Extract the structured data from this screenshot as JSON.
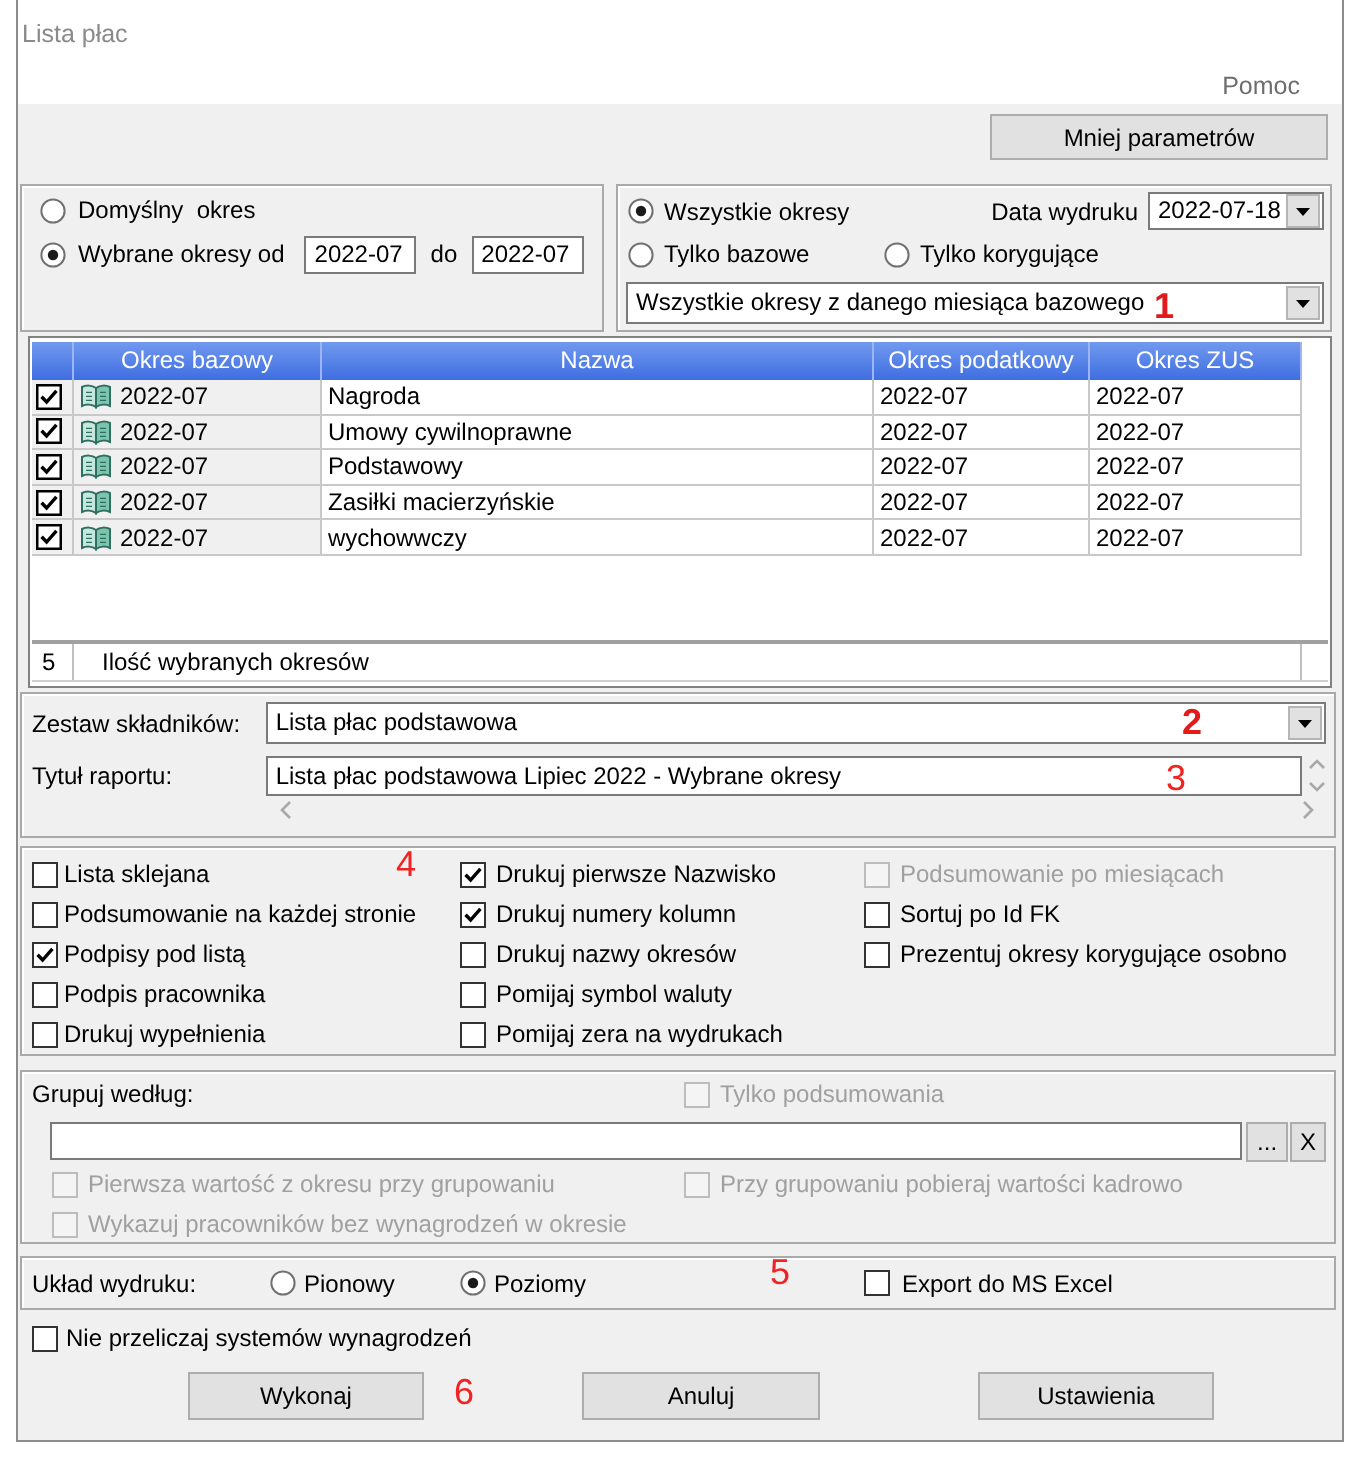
{
  "window": {
    "title": "Lista płac"
  },
  "menu": [
    {
      "label": "Pomoc"
    }
  ],
  "toggle_button": {
    "label": "Mniej parametrów"
  },
  "period_range": {
    "options": [
      {
        "label": "Domyślny  okres",
        "selected": false
      },
      {
        "label": "Wybrane okresy od",
        "selected": true
      }
    ],
    "from": "2022-07",
    "to_label": "do",
    "to": "2022-07"
  },
  "period_filter": {
    "options": [
      {
        "label": "Wszystkie okresy",
        "selected": true
      },
      {
        "label": "Tylko bazowe",
        "selected": false
      },
      {
        "label": "Tylko korygujące",
        "selected": false
      }
    ],
    "print_date_label": "Data wydruku",
    "print_date": "2022-07-18",
    "scope": "Wszystkie okresy z danego miesiąca bazowego"
  },
  "periods_table": {
    "columns": [
      "Okres bazowy",
      "Nazwa",
      "Okres podatkowy",
      "Okres ZUS"
    ],
    "rows": [
      {
        "checked": true,
        "base": "2022-07",
        "name": "Nagroda",
        "tax": "2022-07",
        "zus": "2022-07"
      },
      {
        "checked": true,
        "base": "2022-07",
        "name": "Umowy cywilnoprawne",
        "tax": "2022-07",
        "zus": "2022-07"
      },
      {
        "checked": true,
        "base": "2022-07",
        "name": "Podstawowy",
        "tax": "2022-07",
        "zus": "2022-07"
      },
      {
        "checked": true,
        "base": "2022-07",
        "name": "Zasiłki macierzyńskie",
        "tax": "2022-07",
        "zus": "2022-07"
      },
      {
        "checked": true,
        "base": "2022-07",
        "name": "wychowwczy",
        "tax": "2022-07",
        "zus": "2022-07"
      }
    ],
    "footer": {
      "count": "5",
      "label": "Ilość wybranych okresów"
    }
  },
  "component_set": {
    "label": "Zestaw składników:",
    "value": "Lista płac podstawowa"
  },
  "report_title": {
    "label": "Tytuł raportu:",
    "value": "Lista płac podstawowa Lipiec 2022 - Wybrane okresy"
  },
  "print_options": [
    {
      "items": [
        {
          "label": "Lista sklejana",
          "checked": false,
          "disabled": false
        },
        {
          "label": "Podsumowanie na każdej stronie",
          "checked": false,
          "disabled": false
        },
        {
          "label": "Podpisy pod listą",
          "checked": true,
          "disabled": false
        },
        {
          "label": "Podpis pracownika",
          "checked": false,
          "disabled": false
        },
        {
          "label": "Drukuj wypełnienia",
          "checked": false,
          "disabled": false
        }
      ]
    },
    {
      "items": [
        {
          "label": "Drukuj pierwsze Nazwisko",
          "checked": true,
          "disabled": false
        },
        {
          "label": "Drukuj numery kolumn",
          "checked": true,
          "disabled": false
        },
        {
          "label": "Drukuj nazwy okresów",
          "checked": false,
          "disabled": false
        },
        {
          "label": "Pomijaj symbol waluty",
          "checked": false,
          "disabled": false
        },
        {
          "label": "Pomijaj zera na wydrukach",
          "checked": false,
          "disabled": false
        }
      ]
    },
    {
      "items": [
        {
          "label": "Podsumowanie po miesiącach",
          "checked": false,
          "disabled": true
        },
        {
          "label": "Sortuj po Id FK",
          "checked": false,
          "disabled": false
        },
        {
          "label": "Prezentuj okresy korygujące osobno",
          "checked": false,
          "disabled": false
        }
      ]
    }
  ],
  "grouping": {
    "label": "Grupuj według:",
    "summary_only": {
      "label": "Tylko podsumowania",
      "checked": false,
      "disabled": true
    },
    "browse_button": "...",
    "clear_button": "X",
    "options": [
      {
        "label": "Pierwsza wartość z okresu przy grupowaniu",
        "checked": false,
        "disabled": true
      },
      {
        "label": "Przy grupowaniu pobieraj wartości kadrowo",
        "checked": false,
        "disabled": true
      },
      {
        "label": "Wykazuj pracowników bez wynagrodzeń w okresie",
        "checked": false,
        "disabled": true
      }
    ]
  },
  "print_layout": {
    "label": "Układ wydruku:",
    "options": [
      {
        "label": "Pionowy",
        "selected": false
      },
      {
        "label": "Poziomy",
        "selected": true
      }
    ],
    "export": {
      "label": "Export do MS Excel",
      "checked": false
    }
  },
  "no_recalc": {
    "label": "Nie przeliczaj systemów wynagrodzeń",
    "checked": false
  },
  "buttons": [
    {
      "label": "Wykonaj"
    },
    {
      "label": "Anuluj"
    },
    {
      "label": "Ustawienia"
    }
  ],
  "annotations": [
    {
      "text": "1",
      "bold": true
    },
    {
      "text": "2",
      "bold": true
    },
    {
      "text": "3",
      "bold": false
    },
    {
      "text": "4",
      "bold": false
    },
    {
      "text": "5",
      "bold": false
    },
    {
      "text": "6",
      "bold": false
    }
  ]
}
